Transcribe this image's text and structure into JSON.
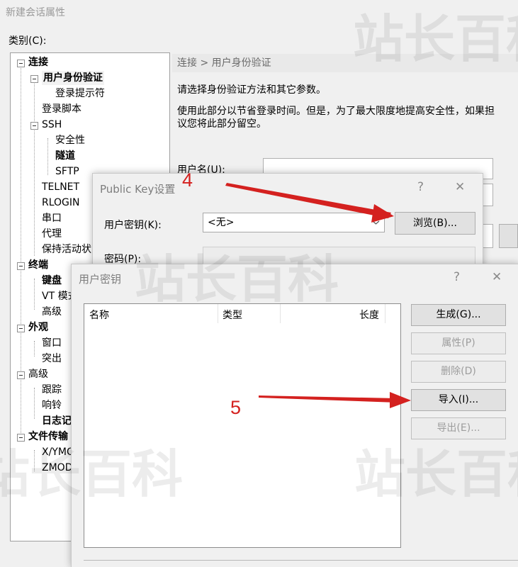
{
  "window": {
    "title": "新建会话属性",
    "category_label": "类别(C):"
  },
  "tree": [
    {
      "label": "连接",
      "bold": true
    },
    {
      "label": "用户身份验证",
      "bold": true
    },
    {
      "label": "登录提示符"
    },
    {
      "label": "登录脚本"
    },
    {
      "label": "SSH"
    },
    {
      "label": "安全性"
    },
    {
      "label": "隧道",
      "bold": true
    },
    {
      "label": "SFTP"
    },
    {
      "label": "TELNET"
    },
    {
      "label": "RLOGIN"
    },
    {
      "label": "串口"
    },
    {
      "label": "代理"
    },
    {
      "label": "保持活动状"
    },
    {
      "label": "终端",
      "bold": true
    },
    {
      "label": "键盘",
      "bold": true
    },
    {
      "label": "VT 模式"
    },
    {
      "label": "高级"
    },
    {
      "label": "外观",
      "bold": true
    },
    {
      "label": "窗口"
    },
    {
      "label": "突出"
    },
    {
      "label": "高级"
    },
    {
      "label": "跟踪"
    },
    {
      "label": "响铃"
    },
    {
      "label": "日志记",
      "bold": true
    },
    {
      "label": "文件传输",
      "bold": true
    },
    {
      "label": "X/YMO"
    },
    {
      "label": "ZMOD"
    }
  ],
  "panel": {
    "breadcrumb": "连接 > 用户身份验证",
    "desc1": "请选择身份验证方法和其它参数。",
    "desc2a": "使用此部分以节省登录时间。但是，为了最大限度地提高安全性，如果担",
    "desc2b": "议您将此部分留空。",
    "username_label": "用户名(U):"
  },
  "pubkey_dialog": {
    "title": "Public Key设置",
    "help": "?",
    "close": "✕",
    "user_key_label": "用户密钥(K):",
    "user_key_value": "<无>",
    "browse_button": "浏览(B)...",
    "password_label": "密码(P):"
  },
  "userkey_dialog": {
    "title": "用户密钥",
    "help": "?",
    "close": "✕",
    "columns": [
      "名称",
      "类型",
      "长度"
    ],
    "buttons": {
      "generate": "生成(G)...",
      "properties": "属性(P)",
      "delete": "删除(D)",
      "import": "导入(I)...",
      "export": "导出(E)..."
    }
  },
  "annotations": {
    "step4": "4",
    "step5": "5",
    "color": "#d4211f"
  },
  "watermark": {
    "text": "站长百科"
  }
}
